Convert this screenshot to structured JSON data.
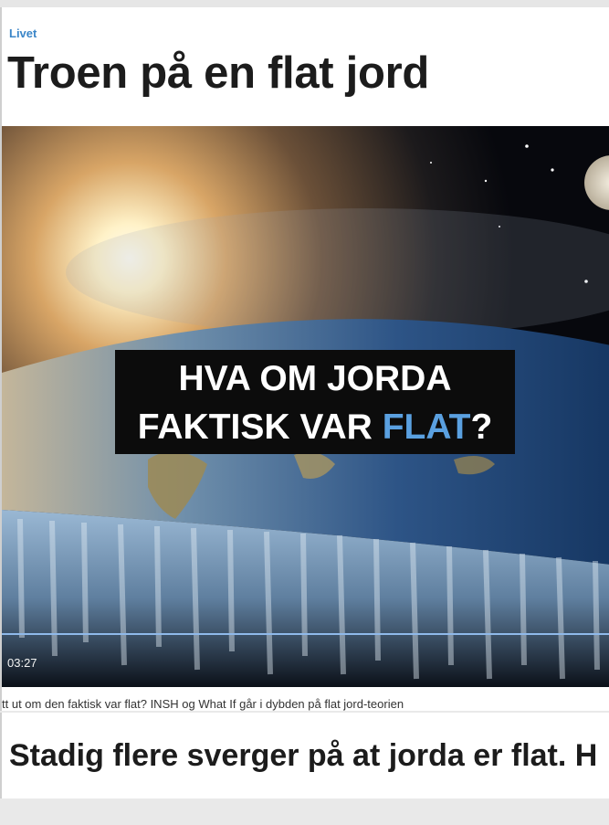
{
  "article": {
    "category": "Livet",
    "headline": "Troen på en flat jord"
  },
  "video": {
    "overlay_line1": "HVA OM JORDA",
    "overlay_line2_prefix": "FAKTISK VAR ",
    "overlay_line2_highlight": "FLAT",
    "overlay_line2_suffix": "?",
    "duration": "03:27",
    "progress_fraction": 1.0,
    "highlight_color": "#5aa0e0",
    "caption": "tt ut om den faktisk var flat? INSH og What If går i dybden på flat jord-teorien"
  },
  "next_article": {
    "headline": "Stadig flere sverger på at jorda er flat. H"
  },
  "colors": {
    "accent": "#3b86c8",
    "progress": "#4a79b8"
  }
}
